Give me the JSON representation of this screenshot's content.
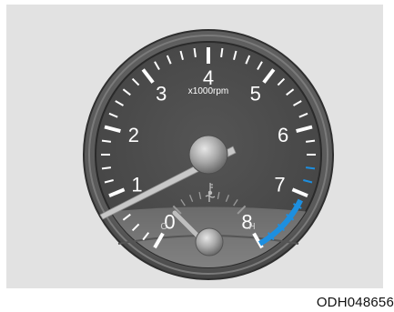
{
  "gauge": {
    "type": "tachometer",
    "unit_label": "x1000rpm",
    "scale": [
      0,
      8
    ],
    "major_labels": [
      "0",
      "1",
      "2",
      "3",
      "4",
      "5",
      "6",
      "7",
      "8"
    ],
    "needle_value": 0,
    "red_zone": [
      6.5,
      8
    ],
    "red_zone_color": "#1d8fe0",
    "face_color": "#4b4b4b",
    "tick_color": "#ffffff"
  },
  "temp_gauge": {
    "type": "coolant-temperature",
    "cold_label": "C",
    "hot_label": "H",
    "icon": "coolant-temperature-icon",
    "needle_level": 0
  },
  "caption": {
    "code": "ODH048656"
  }
}
